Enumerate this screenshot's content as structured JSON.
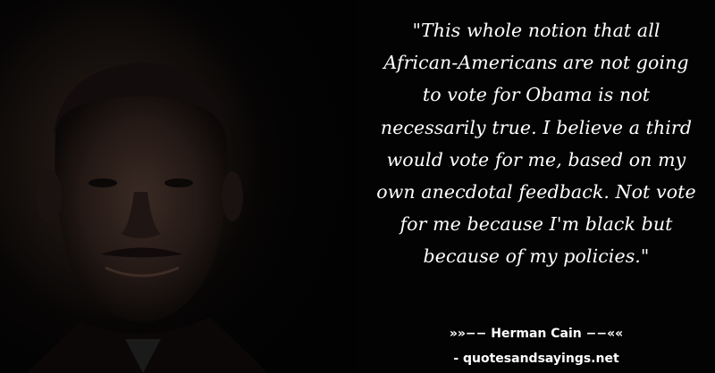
{
  "quote": {
    "text": "\"This whole notion that all African-Americans are not going to vote for Obama is not necessarily true. I believe a third would vote for me, based on my own anecdotal feedback. Not vote for me because I'm black but because of my policies.\""
  },
  "attribution": {
    "prefix": "»»−− ",
    "author": "Herman Cain",
    "suffix": " −−««"
  },
  "site": {
    "label": "- quotesandsayings.net"
  },
  "colors": {
    "background": "#030303",
    "text": "#ffffff"
  }
}
